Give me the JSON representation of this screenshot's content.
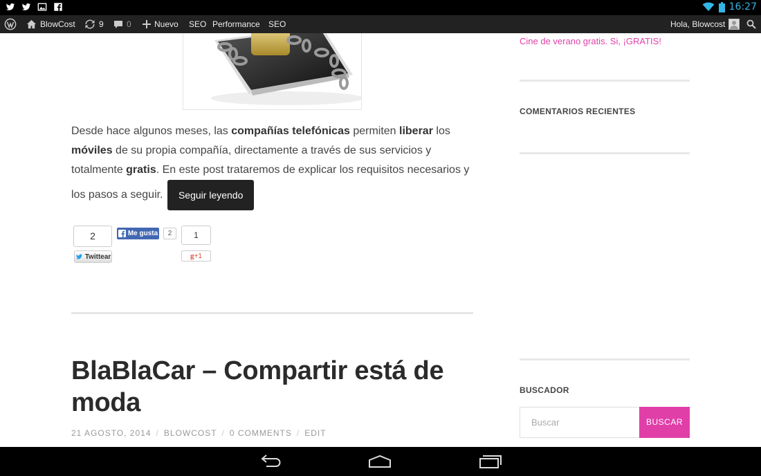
{
  "statusbar": {
    "icons_left": [
      "twitter-icon",
      "twitter-icon",
      "image-icon",
      "facebook-icon"
    ],
    "time": "16:27"
  },
  "adminbar": {
    "site_name": "BlowCost",
    "updates_count": "9",
    "comments_count": "0",
    "new_label": "Nuevo",
    "menu_seo_1": "SEO",
    "menu_performance": "Performance",
    "menu_seo_2": "SEO",
    "greeting": "Hola, Blowcost"
  },
  "post1": {
    "excerpt": {
      "t1": "Desde hace algunos meses, las ",
      "b1": "compañías telefónicas",
      "t2": "  permiten  ",
      "b2": "liberar",
      "t3": " los ",
      "b3": "móviles",
      "t4": " de su propia compañía, directamente a través de sus servicios y totalmente ",
      "b4": "gratis",
      "t5": ". En este post trataremos de explicar los requisitos necesarios y los pasos a seguir. "
    },
    "read_more": "Seguir leyendo",
    "share": {
      "twitter_count": "2",
      "twitter_label": "Twittear",
      "facebook_label": "Me gusta",
      "facebook_count": "2",
      "gplus_count": "1",
      "gplus_label": "+1"
    }
  },
  "post2": {
    "title": "BlaBlaCar – Compartir está de moda",
    "date": "21 AGOSTO, 2014",
    "author": "BLOWCOST",
    "comments": "0 COMMENTS",
    "edit": "EDIT"
  },
  "sidebar": {
    "recent_link": "Cine de verano gratis. Si, ¡GRATIS!",
    "recent_comments_title": "COMENTARIOS RECIENTES",
    "search_title": "BUSCADOR",
    "search_placeholder": "Buscar",
    "search_button": "BUSCAR"
  },
  "colors": {
    "accent": "#e13fa8",
    "adminbar": "#222222",
    "status_time": "#33b5e5"
  }
}
